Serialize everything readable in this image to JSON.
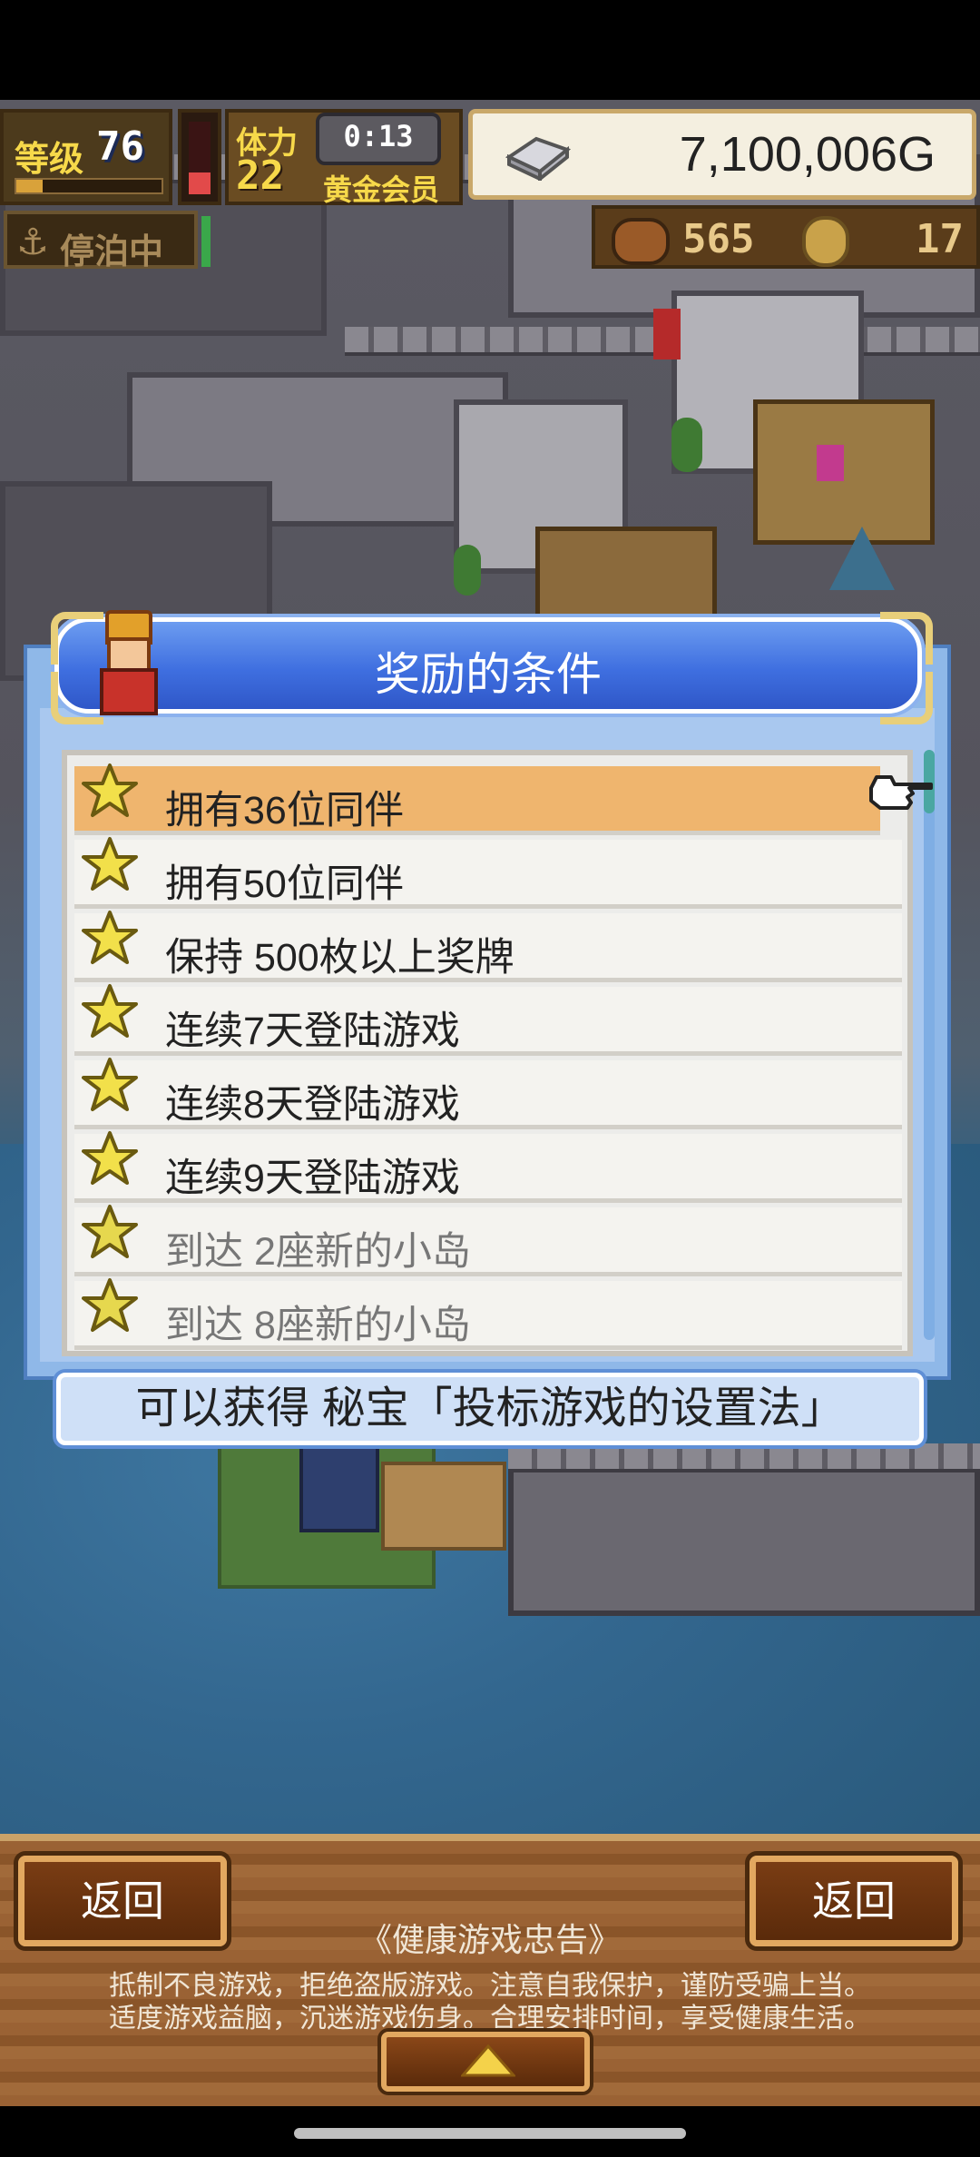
{
  "hud": {
    "level_label": "等级",
    "level_value": "76",
    "stamina_label": "体力",
    "stamina_value": "22",
    "timer": "0:13",
    "membership": "黄金会员",
    "gold": "7,100,006G",
    "status": "停泊中",
    "food_count": "565",
    "medal_count": "17",
    "icons": [
      "anchor-icon",
      "silver-bar-icon",
      "food-icon",
      "medal-icon"
    ]
  },
  "dialog": {
    "title": "奖励的条件",
    "conditions": [
      {
        "label": "拥有36位同伴",
        "selected": true,
        "dim": false
      },
      {
        "label": "拥有50位同伴",
        "selected": false,
        "dim": false
      },
      {
        "label": "保持 500枚以上奖牌",
        "selected": false,
        "dim": false
      },
      {
        "label": "连续7天登陆游戏",
        "selected": false,
        "dim": false
      },
      {
        "label": "连续8天登陆游戏",
        "selected": false,
        "dim": false
      },
      {
        "label": "连续9天登陆游戏",
        "selected": false,
        "dim": false
      },
      {
        "label": "到达 2座新的小岛",
        "selected": false,
        "dim": true
      },
      {
        "label": "到达 8座新的小岛",
        "selected": false,
        "dim": true
      }
    ],
    "reward_text": "可以获得 秘宝「投标游戏的设置法」"
  },
  "bottom": {
    "left_button": "返回",
    "right_button": "返回",
    "notice_title": "《健康游戏忠告》",
    "notice_line1": "抵制不良游戏，拒绝盗版游戏。注意自我保护，谨防受骗上当。",
    "notice_line2": "适度游戏益脑，沉迷游戏伤身。合理安排时间，享受健康生活。"
  },
  "colors": {
    "title_blue": "#3f6fe0",
    "selected_row": "#efb56e",
    "wood": "#9a6234",
    "water": "#33678f"
  }
}
